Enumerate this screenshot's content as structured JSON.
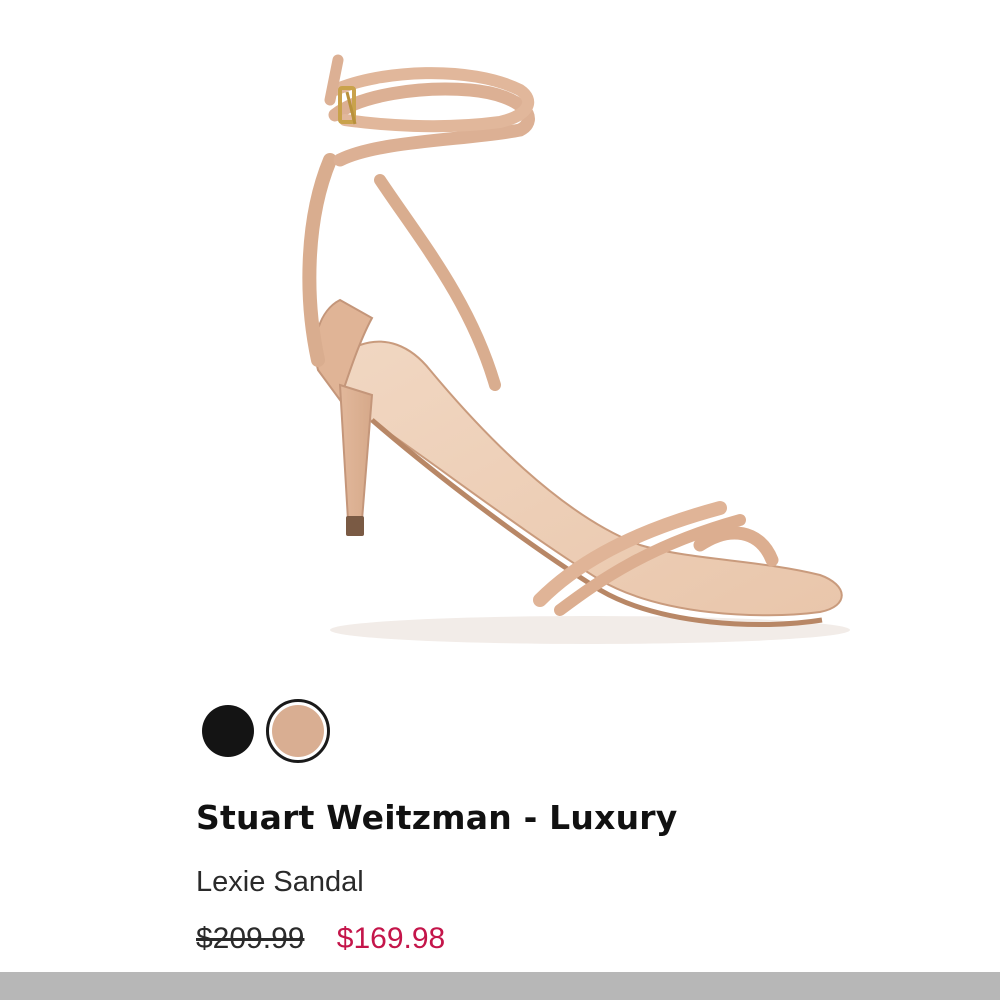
{
  "product": {
    "brand": "Stuart Weitzman - Luxury",
    "name": "Lexie Sandal",
    "original_price": "$209.99",
    "sale_price": "$169.98"
  },
  "swatches": [
    {
      "color": "#141414",
      "selected": false
    },
    {
      "color": "#d9ae92",
      "selected": true
    }
  ],
  "colors": {
    "sale_price": "#c4154a",
    "bottom_bar": "#b7b7b7"
  }
}
